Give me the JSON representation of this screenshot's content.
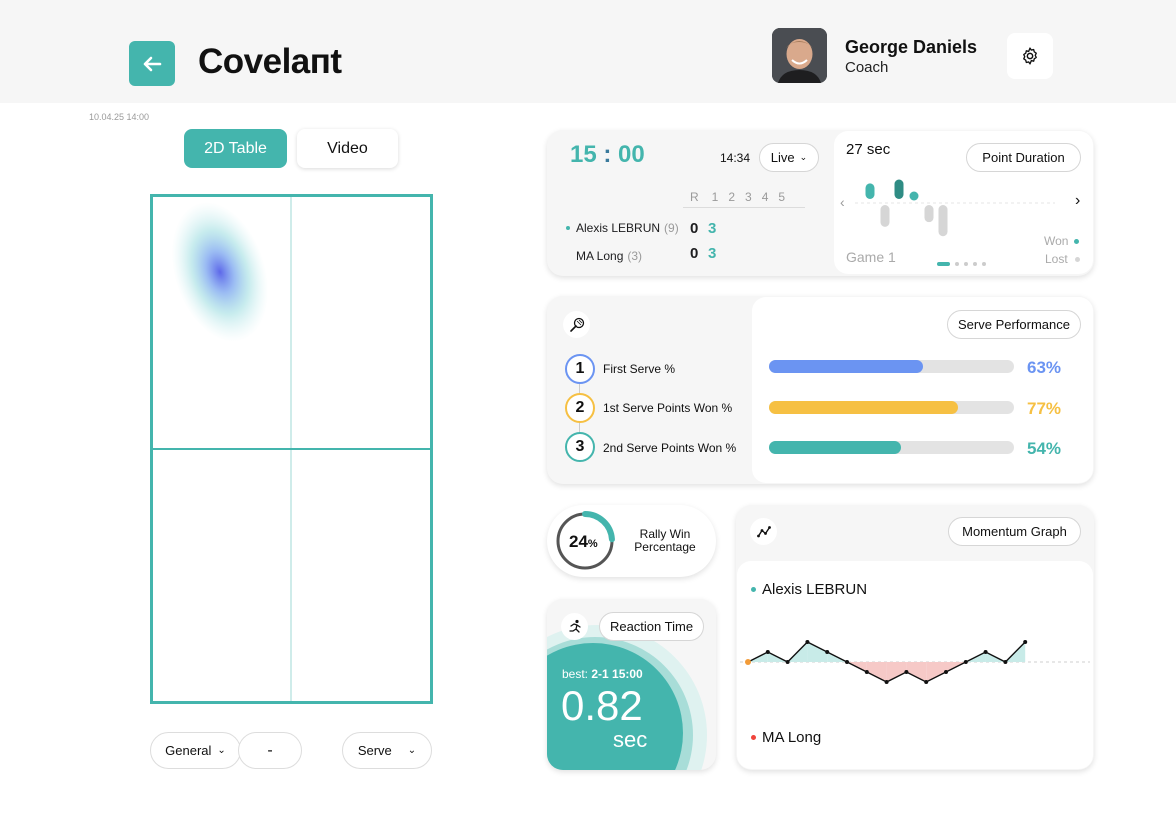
{
  "header": {
    "app_name": "Covelaпt",
    "user_name": "George Daniels",
    "user_role": "Coach",
    "timestamp": "10.04.25 14:00"
  },
  "view_tabs": [
    "2D Table",
    "Video"
  ],
  "filters": {
    "general": "General",
    "separator": "-",
    "serve": "Serve"
  },
  "scoreboard": {
    "clock": "15 : 00",
    "clock_left": "15",
    "clock_sep": ":",
    "clock_right": "00",
    "time": "14:34",
    "mode": "Live",
    "col_headers": [
      "R",
      "1",
      "2",
      "3",
      "4",
      "5"
    ],
    "players": [
      {
        "name": "Alexis LEBRUN",
        "rank": "(9)",
        "sets": "0",
        "game": "3",
        "serving": true
      },
      {
        "name": "MA Long",
        "rank": "(3)",
        "sets": "0",
        "game": "3",
        "serving": false
      }
    ]
  },
  "point_duration": {
    "value": "27 sec",
    "button": "Point Duration",
    "game_label": "Game 1",
    "legend_won": "Won",
    "legend_lost": "Lost",
    "points": [
      {
        "result": "won",
        "seconds": 12
      },
      {
        "result": "lost",
        "seconds": 14
      },
      {
        "result": "won",
        "seconds": 15
      },
      {
        "result": "won",
        "seconds": 5
      },
      {
        "result": "lost",
        "seconds": 11
      },
      {
        "result": "lost",
        "seconds": 20
      }
    ]
  },
  "serve_performance": {
    "button": "Serve Performance",
    "items": [
      {
        "index": "1",
        "label": "First Serve %",
        "value": 63,
        "display": "63%",
        "color": "#6b94f2"
      },
      {
        "index": "2",
        "label": "1st Serve Points Won %",
        "value": 77,
        "display": "77%",
        "color": "#f6c043"
      },
      {
        "index": "3",
        "label": "2nd Serve Points Won %",
        "value": 54,
        "display": "54%",
        "color": "#44b5ad"
      }
    ]
  },
  "rally": {
    "value": "24",
    "unit": "%",
    "percent": 24,
    "label_line1": "Rally Win",
    "label_line2": "Percentage"
  },
  "reaction": {
    "button": "Reaction Time",
    "best_label": "best:",
    "best_value": "2-1 15:00",
    "value": "0.82",
    "unit": "sec"
  },
  "momentum": {
    "button": "Momentum Graph",
    "top_player": "Alexis LEBRUN",
    "bottom_player": "MA Long",
    "values": [
      0,
      1,
      0,
      2,
      1,
      0,
      -1,
      -2,
      -1,
      -2,
      -1,
      0,
      1,
      0,
      2
    ]
  },
  "colors": {
    "accent": "#44b5ad",
    "blue": "#6b94f2",
    "yellow": "#f6c043",
    "lost": "#d6d6d6",
    "red_dot": "#f0443c",
    "orange_dot": "#f29b38"
  },
  "heatmap": {
    "zone": "top-left",
    "intensity": "high"
  }
}
